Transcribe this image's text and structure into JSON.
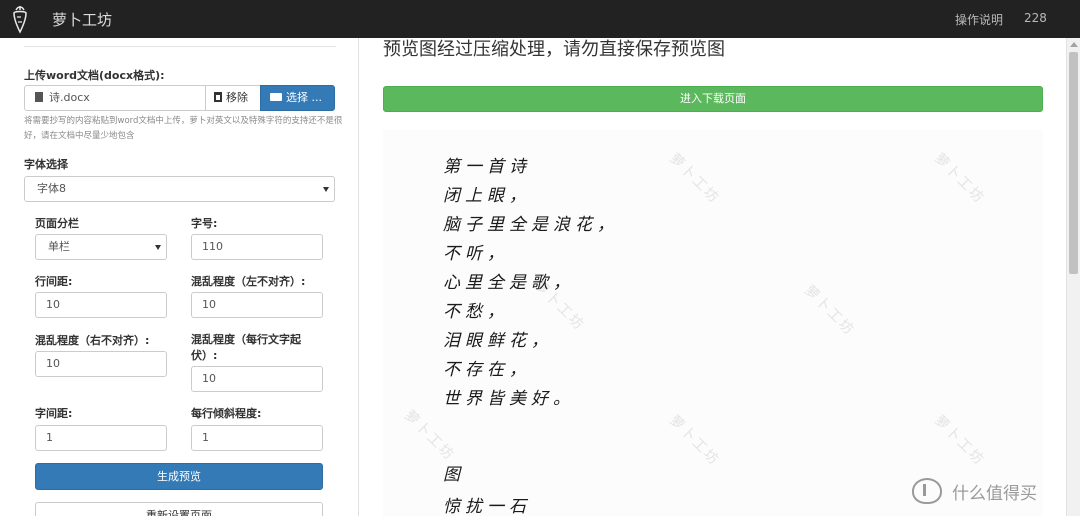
{
  "nav": {
    "brand": "萝卜工坊",
    "help": "操作说明",
    "count": "228"
  },
  "upload": {
    "label": "上传word文档(docx格式):",
    "filename": "诗.docx",
    "remove": "移除",
    "choose": "选择 ...",
    "help": "将需要抄写的内容粘贴到word文档中上传，萝卜对英文以及特殊字符的支持还不是很好，请在文档中尽量少地包含"
  },
  "font": {
    "label": "字体选择",
    "value": "字体8"
  },
  "settings": {
    "columns_label": "页面分栏",
    "columns_value": "单栏",
    "size_label": "字号:",
    "size_value": "110",
    "line_spacing_label": "行间距:",
    "line_spacing_value": "10",
    "chaos_left_label": "混乱程度（左不对齐）:",
    "chaos_left_value": "10",
    "chaos_right_label": "混乱程度（右不对齐）:",
    "chaos_right_value": "10",
    "chaos_line_label": "混乱程度（每行文字起伏）:",
    "chaos_line_value": "10",
    "char_spacing_label": "字间距:",
    "char_spacing_value": "1",
    "tilt_label": "每行倾斜程度:",
    "tilt_value": "1"
  },
  "buttons": {
    "generate": "生成预览",
    "reset": "重新设置页面",
    "download": "进入下载页面"
  },
  "preview": {
    "heading": "预览图经过压缩处理，请勿直接保存预览图",
    "watermark": "萝卜工坊",
    "poem": [
      "第一首诗",
      "闭上眼，",
      "脑子里全是浪花，",
      "不听，",
      "心里全是歌，",
      "不愁，",
      "泪眼鲜花，",
      "不存在，",
      "世界皆美好。",
      "",
      "图",
      "惊扰一石"
    ]
  },
  "corner": {
    "text": "什么值得买"
  },
  "colors": {
    "navbar": "#222222",
    "primary": "#337ab7",
    "success": "#5cb85c"
  }
}
